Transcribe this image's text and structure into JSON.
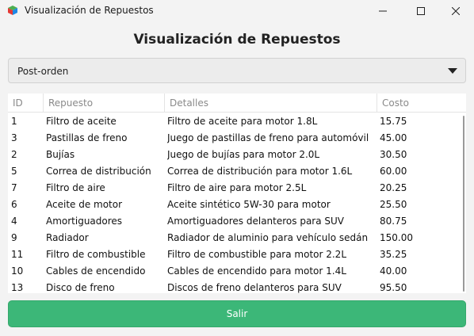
{
  "window": {
    "title": "Visualización de Repuestos"
  },
  "heading": "Visualización de Repuestos",
  "traversal_select": {
    "value": "Post-orden"
  },
  "table": {
    "columns": [
      "ID",
      "Repuesto",
      "Detalles",
      "Costo"
    ],
    "rows": [
      {
        "id": "1",
        "repuesto": "Filtro de aceite",
        "detalles": "Filtro de aceite para motor 1.8L",
        "costo": "15.75"
      },
      {
        "id": "3",
        "repuesto": "Pastillas de freno",
        "detalles": "Juego de pastillas de freno para automóvil",
        "costo": "45.00"
      },
      {
        "id": "2",
        "repuesto": "Bujías",
        "detalles": "Juego de bujías para motor 2.0L",
        "costo": "30.50"
      },
      {
        "id": "5",
        "repuesto": "Correa de distribución",
        "detalles": "Correa de distribución para motor 1.6L",
        "costo": "60.00"
      },
      {
        "id": "7",
        "repuesto": "Filtro de aire",
        "detalles": "Filtro de aire para motor 2.5L",
        "costo": "20.25"
      },
      {
        "id": "6",
        "repuesto": "Aceite de motor",
        "detalles": "Aceite sintético 5W-30 para motor",
        "costo": "25.50"
      },
      {
        "id": "4",
        "repuesto": "Amortiguadores",
        "detalles": "Amortiguadores delanteros para SUV",
        "costo": "80.75"
      },
      {
        "id": "9",
        "repuesto": "Radiador",
        "detalles": "Radiador de aluminio para vehículo sedán",
        "costo": "150.00"
      },
      {
        "id": "11",
        "repuesto": "Filtro de combustible",
        "detalles": "Filtro de combustible para motor 2.2L",
        "costo": "35.25"
      },
      {
        "id": "10",
        "repuesto": "Cables de encendido",
        "detalles": "Cables de encendido para motor 1.4L",
        "costo": "40.00"
      },
      {
        "id": "13",
        "repuesto": "Disco de freno",
        "detalles": "Discos de freno delanteros para SUV",
        "costo": "95.50"
      }
    ]
  },
  "exit_button": {
    "label": "Salir"
  },
  "colors": {
    "accent_green": "#3cb778",
    "background": "#f3f3f3"
  },
  "icons": {
    "app": "app-cube-icon",
    "minimize": "minimize-icon",
    "maximize": "maximize-icon",
    "close": "close-icon",
    "dropdown": "caret-down-icon"
  }
}
